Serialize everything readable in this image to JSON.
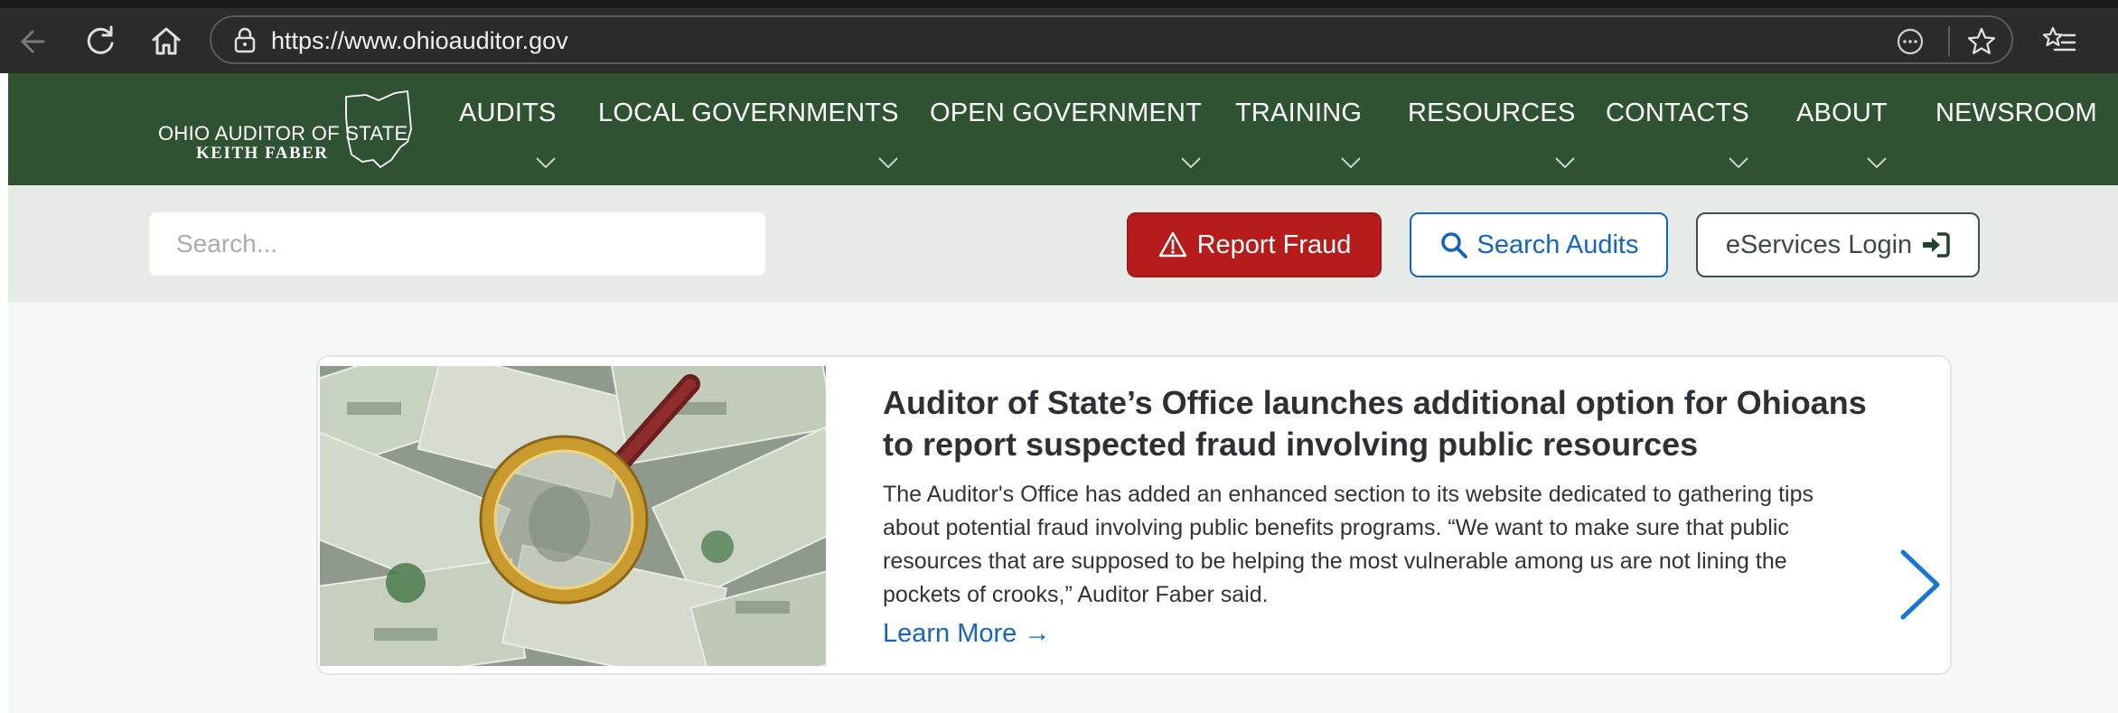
{
  "browser": {
    "url": "https://www.ohioauditor.gov",
    "icons": [
      "back-icon",
      "refresh-icon",
      "home-icon",
      "site-info-icon",
      "more-icon",
      "favorite-star-icon",
      "favorites-list-icon"
    ]
  },
  "nav": {
    "logo_line1": "OHIO AUDITOR OF STATE",
    "logo_line2": "KEITH FABER",
    "items": [
      {
        "label": "AUDITS"
      },
      {
        "label": "LOCAL GOVERNMENTS"
      },
      {
        "label": "OPEN GOVERNMENT"
      },
      {
        "label": "TRAINING"
      },
      {
        "label": "RESOURCES"
      },
      {
        "label": "CONTACTS"
      },
      {
        "label": "ABOUT"
      },
      {
        "label": "NEWSROOM"
      }
    ]
  },
  "utility": {
    "search_placeholder": "Search...",
    "report_fraud": "Report Fraud",
    "search_audits": "Search Audits",
    "eservices_login": "eServices Login"
  },
  "news": {
    "title": "Auditor of State’s Office launches additional option for Ohioans to report suspected fraud involving public resources",
    "body": "The Auditor's Office has added an enhanced section to its website dedicated to gathering tips about potential fraud involving public benefits programs. “We want to make sure that public resources that are supposed to be helping the most vulnerable among us are not lining the pockets of crooks,” Auditor Faber said.",
    "learn_more": "Learn More →"
  },
  "colors": {
    "nav_green": "#2f5233",
    "fraud_red": "#b71c1c",
    "link_blue": "#1565c0",
    "utility_bg": "#e6ebe8"
  }
}
